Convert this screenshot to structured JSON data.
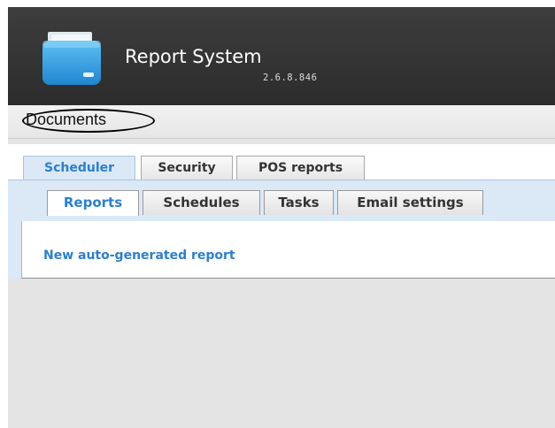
{
  "app": {
    "title": "Report System",
    "version": "2.6.8.846",
    "logo_icon": "folder-icon"
  },
  "docbar": {
    "documents_label": "Documents"
  },
  "main_tabs": [
    {
      "label": "Scheduler",
      "active": true
    },
    {
      "label": "Security",
      "active": false
    },
    {
      "label": "POS reports",
      "active": false
    }
  ],
  "sub_tabs": [
    {
      "label": "Reports",
      "active": true
    },
    {
      "label": "Schedules",
      "active": false
    },
    {
      "label": "Tasks",
      "active": false
    },
    {
      "label": "Email settings",
      "active": false
    }
  ],
  "reports": [
    {
      "label": "New auto-generated report"
    }
  ],
  "colors": {
    "header_bg": "#333333",
    "accent": "#2b7fd1",
    "panel_bg": "#dbe8f5",
    "page_bg": "#e4e4e4",
    "annotation": "#000000"
  }
}
